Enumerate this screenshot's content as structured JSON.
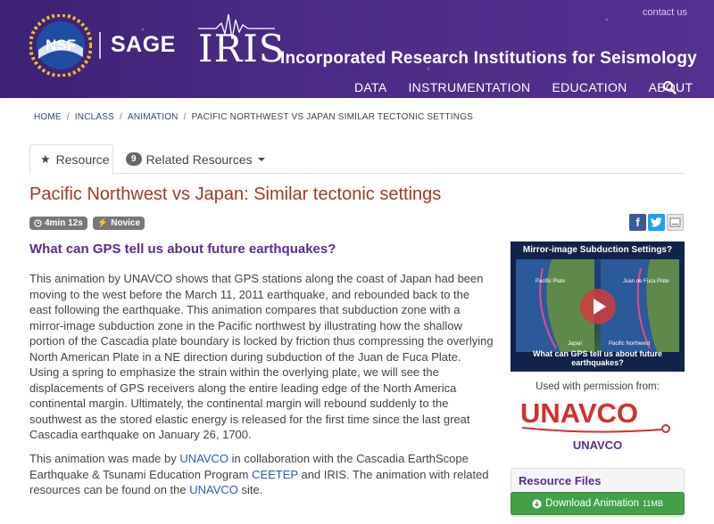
{
  "header": {
    "contact": "contact us",
    "nsf_text": "NSF",
    "sage": "SAGE",
    "iris": "IRIS",
    "iris_full": "Incorporated Research Institutions for Seismology",
    "nav": [
      "DATA",
      "INSTRUMENTATION",
      "EDUCATION",
      "ABOUT"
    ]
  },
  "breadcrumb": [
    "HOME",
    "INCLASS",
    "ANIMATION",
    "PACIFIC NORTHWEST VS JAPAN SIMILAR TECTONIC SETTINGS"
  ],
  "tabs": {
    "resource": "Resource",
    "related_count": "9",
    "related": "Related Resources"
  },
  "title": "Pacific Northwest vs Japan: Similar tectonic settings",
  "meta": {
    "duration": "4min 12s",
    "level": "Novice"
  },
  "subhead": "What can GPS tell us about future earthquakes?",
  "para1": "This animation by UNAVCO shows that GPS stations along the coast of Japan had been moving to the west before the March 11, 2011 earthquake, and rebounded back to the east following the earthquake. This animation compares that subduction zone with a mirror-image subduction zone in the Pacific northwest by illustrating how the shallow portion of the Cascadia plate boundary is locked by friction thus compressing the overlying North American Plate in a NE direction during subduction of the Juan de Fuca Plate. Using a spring to emphasize the strain within the overlying plate, we will see the displacements of GPS receivers along the entire leading edge of the North America continental margin. Ultimately, the continental margin will rebound suddenly to the southwest as the stored elastic energy is released for the first time since the last great Cascadia earthquake on January 26, 1700.",
  "para2": {
    "t1": "This animation was made by ",
    "l1": "UNAVCO",
    "t2": " in collaboration with the Cascadia EarthScope Earthquake & Tsunami Education Program ",
    "l2": "CEETEP",
    "t3": " and IRIS. The animation with related resources can be found on the ",
    "l3": "UNAVCO",
    "t4": " site."
  },
  "video": {
    "top": "Mirror-image Subduction Settings?",
    "bottom": "What can GPS tell us about future earthquakes?",
    "label_pacific": "Pacific Plate",
    "label_jdf": "Juan de Fuca Plate",
    "label_japan": "Japan",
    "label_pnw": "Pacific Northwest"
  },
  "permission": "Used with permission from:",
  "unavco_logo": "UNAVCO",
  "unavco_name": "UNAVCO",
  "resource_files": {
    "heading": "Resource Files",
    "download": "Download Animation",
    "size": "11MB"
  },
  "colors": {
    "header": "#4b2a85",
    "title": "#a23b23",
    "accent": "#5b2d8c",
    "link": "#2a5db0",
    "download": "#43a047",
    "unavco_red": "#d32f2f"
  }
}
